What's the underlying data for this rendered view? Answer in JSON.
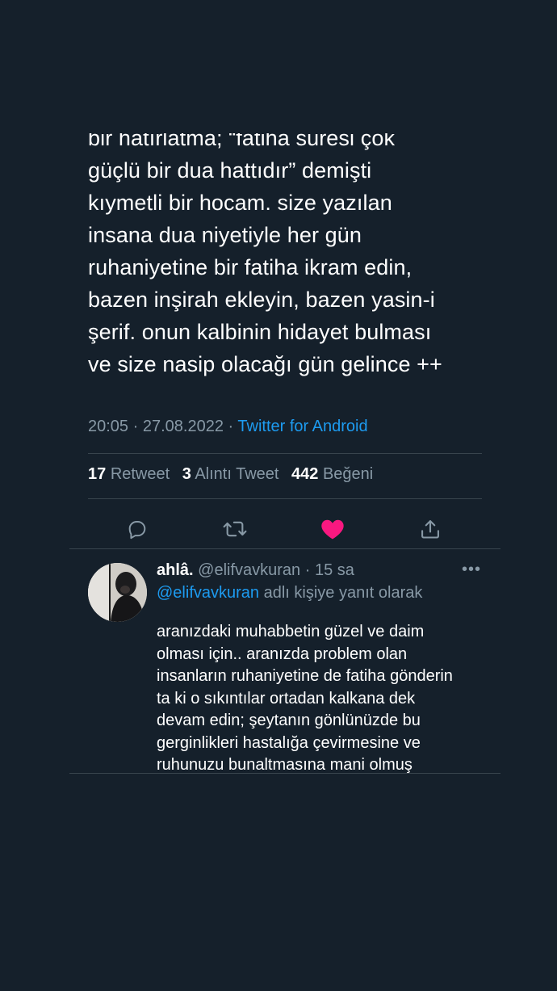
{
  "tweet": {
    "text": "bir hatırlatma; “fatiha suresi çok\ngüçlü bir dua hattıdır” demişti\nkıymetli bir hocam. size yazılan\ninsana dua niyetiyle her gün\nruhaniyetine bir fatiha ikram edin,\nbazen inşirah ekleyin, bazen yasin-i\nşerif. onun kalbinin hidayet bulması\nve size nasip olacağı gün gelince ++",
    "time": "20:05",
    "date": "27.08.2022",
    "separator": "·",
    "source": "Twitter for Android"
  },
  "stats": {
    "retweets_count": "17",
    "retweets_label": "Retweet",
    "quotes_count": "3",
    "quotes_label": "Alıntı Tweet",
    "likes_count": "442",
    "likes_label": "Beğeni"
  },
  "actions": [
    {
      "icon": "reply-icon"
    },
    {
      "icon": "retweet-icon"
    },
    {
      "icon": "heart-icon",
      "liked": true,
      "color": "#f91880"
    },
    {
      "icon": "share-icon"
    }
  ],
  "reply": {
    "display_name": "ahlâ.",
    "handle": "@elifvavkuran",
    "time_ago": "15 sa",
    "separator": "·",
    "more_label": "•••",
    "reply_to_mention": "@elifvavkuran",
    "reply_to_suffix": "adlı kişiye yanıt olarak",
    "text": "aranızdaki muhabbetin güzel ve daim\nolması için.. aranızda problem olan\ninsanların ruhaniyetine de fatiha gönderin\nta ki o sıkıntılar ortadan kalkana dek\ndevam edin; şeytanın gönlünüzde bu\ngerginlikleri hastalığa çevirmesine ve\nruhunuzu bunaltmasına mani olmuş\nolursunuz"
  },
  "colors": {
    "background": "#15202b",
    "text": "#ffffff",
    "secondary": "#8899a6",
    "link": "#1d9bf0",
    "divider": "#38444d",
    "like": "#f91880"
  }
}
